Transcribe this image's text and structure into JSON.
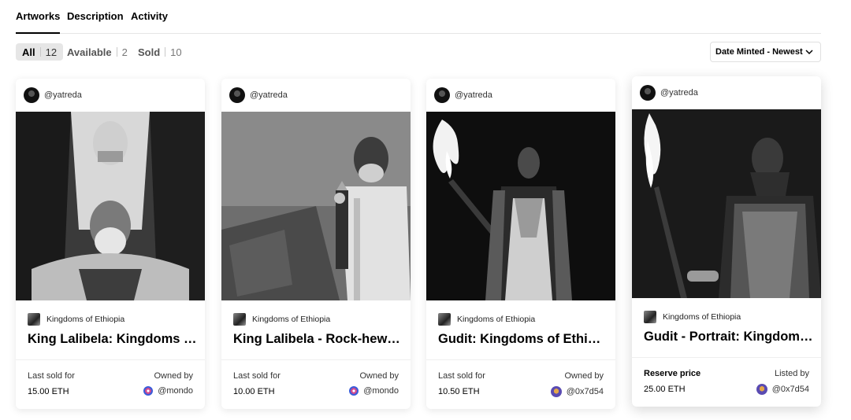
{
  "tabs": [
    {
      "label": "Artworks",
      "active": true
    },
    {
      "label": "Description",
      "active": false
    },
    {
      "label": "Activity",
      "active": false
    }
  ],
  "filters": [
    {
      "label": "All",
      "count": "12",
      "active": true
    },
    {
      "label": "Available",
      "count": "2",
      "active": false
    },
    {
      "label": "Sold",
      "count": "10",
      "active": false
    }
  ],
  "sort": {
    "selected": "Date Minted - Newest",
    "icon": "chevron-down-icon"
  },
  "cards": [
    {
      "creator": "@yatreda",
      "collection": "Kingdoms of Ethiopia",
      "title": "King Lalibela: Kingdoms of Ethiopia",
      "left_label": "Last sold for",
      "left_value": "15.00 ETH",
      "right_label": "Owned by",
      "right_value": "@mondo"
    },
    {
      "creator": "@yatreda",
      "collection": "Kingdoms of Ethiopia",
      "title": "King Lalibela - Rock-hewn Churches",
      "left_label": "Last sold for",
      "left_value": "10.00 ETH",
      "right_label": "Owned by",
      "right_value": "@mondo"
    },
    {
      "creator": "@yatreda",
      "collection": "Kingdoms of Ethiopia",
      "title": "Gudit: Kingdoms of Ethiopia",
      "left_label": "Last sold for",
      "left_value": "10.50 ETH",
      "right_label": "Owned by",
      "right_value": "@0x7d54"
    },
    {
      "creator": "@yatreda",
      "collection": "Kingdoms of Ethiopia",
      "title": "Gudit - Portrait: Kingdoms of Ethiopia",
      "left_label": "Reserve price",
      "left_value": "25.00 ETH",
      "right_label": "Listed by",
      "right_value": "@0x7d54"
    }
  ]
}
